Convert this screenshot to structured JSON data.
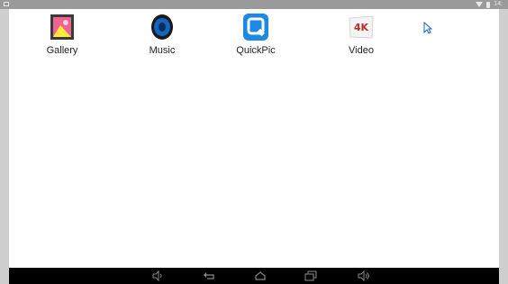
{
  "status_bar": {
    "time": "14:"
  },
  "apps": [
    {
      "label": "Gallery",
      "icon": "gallery-icon"
    },
    {
      "label": "Music",
      "icon": "music-icon"
    },
    {
      "label": "QuickPic",
      "icon": "quickpic-icon"
    },
    {
      "label": "Video",
      "icon": "video-4k-icon",
      "badge_text": "4K"
    }
  ],
  "nav_bar": {
    "buttons": [
      "volume-down-icon",
      "back-icon",
      "home-icon",
      "recents-icon",
      "volume-up-icon"
    ]
  },
  "colors": {
    "status_bar": "#9a9a9a",
    "nav_bar": "#000000",
    "quickpic_blue": "#1e88e5",
    "video_red": "#c62828"
  }
}
